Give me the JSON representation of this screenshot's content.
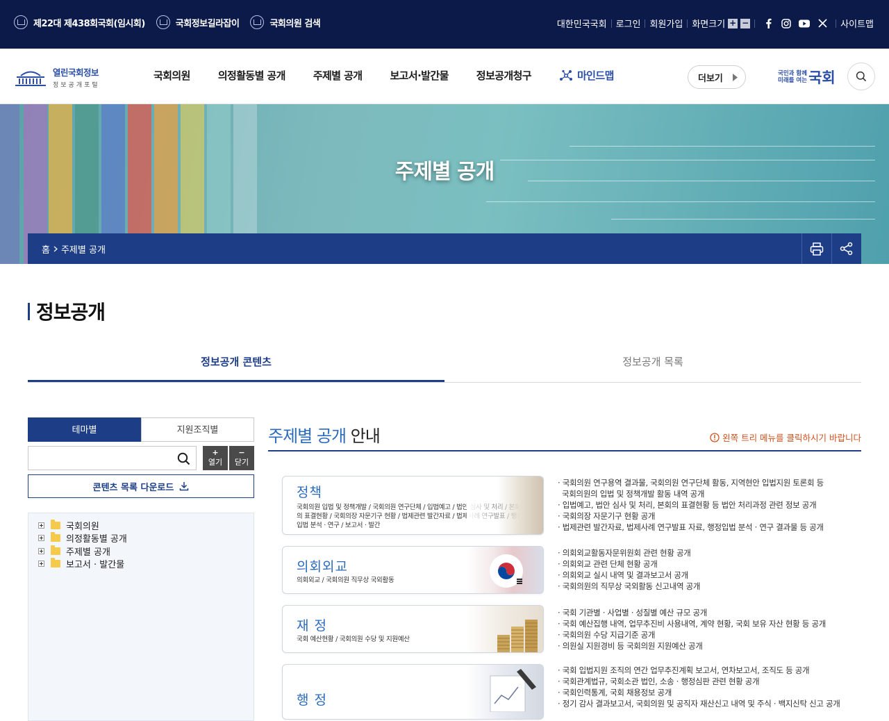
{
  "topbar": {
    "links": [
      "제22대 제438회국회(임시회)",
      "국회정보길라잡이",
      "국회의원 검색"
    ],
    "right": {
      "assembly": "대한민국국회",
      "login": "로그인",
      "signup": "회원가입",
      "zoom_label": "화면크기",
      "zoom_in": "+",
      "zoom_out": "−",
      "sitemap": "사이트맵",
      "social": [
        "facebook-icon",
        "instagram-icon",
        "youtube-icon",
        "x-icon"
      ]
    }
  },
  "header": {
    "logo_title": "열린국회정보",
    "logo_sub": "정보공개포털",
    "nav": [
      "국회의원",
      "의정활동별 공개",
      "주제별 공개",
      "보고서·발간물",
      "정보공개청구"
    ],
    "mindmap": "마인드맵",
    "more": "더보기",
    "slogan_small_1": "국민과 함께",
    "slogan_small_2": "미래를 여는",
    "slogan_big": "국회"
  },
  "banner": {
    "title": "주제별 공개",
    "breadcrumb_home": "홈",
    "breadcrumb_current": "주제별 공개"
  },
  "section": {
    "title": "정보공개",
    "tabs": [
      "정보공개 콘텐츠",
      "정보공개 목록"
    ]
  },
  "left_panel": {
    "tabs": [
      "테마별",
      "지원조직별"
    ],
    "search_placeholder": "",
    "open_label": "열기",
    "close_label": "닫기",
    "download_label": "콘텐츠 목록 다운로드",
    "tree": [
      "국회의원",
      "의정활동별 공개",
      "주제별 공개",
      "보고서 · 발간물"
    ]
  },
  "content": {
    "title_blue": "주제별 공개",
    "title_dark": "안내",
    "note": "왼쪽 트리 메뉴를 클릭하시기 바랍니다",
    "cards": [
      {
        "title": "정책",
        "sub": "국회의원 입법 및 정책개발 / 국회의원 연구단체 / 입법예고 / 법안 심사 및 처리 / 본회의 표결현황 / 국회의장 자문기구 현황 / 법제관련 발간자료 / 법제사례 연구발표 / 행정입법 분석 · 연구 / 보고서 · 발간",
        "desc": [
          "· 국회의원 연구용역 결과물, 국회의원 연구단체 활동, 지역현안 입법지원 토론회 등",
          "  국회의원의 입법 및 정책개발 활동 내역 공개",
          "· 입법예고, 법안 심사 및 처리, 본회의 표결현황 등 법안 처리과정 관련 정보 공개",
          "· 국회의장 자문기구 현황 공개",
          "· 법제관련 발간자료, 법제사례 연구발표 자료, 행정입법 분석 · 연구 결과물 등 공개"
        ]
      },
      {
        "title": "의회외교",
        "sub": "의회외교 / 국회의원 직무상 국외활동",
        "desc": [
          "· 의회외교활동자문위원회 관련 현황 공개",
          "· 의회외교 관련 단체 현황 공개",
          "· 의회외교 실시 내역 및 결과보고서 공개",
          "· 국회의원의 직무상 국외활동 신고내역 공개"
        ]
      },
      {
        "title": "재 정",
        "sub": "국회 예산현황 / 국회의원 수당 및 지원예산",
        "desc": [
          "· 국회 기관별 · 사업별 · 성질별 예산 규모 공개",
          "· 국회 예산집행 내역, 업무추진비 사용내역, 계약 현황, 국회 보유 자산 현황 등 공개",
          "· 국회의원 수당 지급기준 공개",
          "· 의원실 지원경비 등 국회의원 지원예산 공개"
        ]
      },
      {
        "title": "행 정",
        "sub": "",
        "desc": [
          "· 국회 입법지원 조직의 연간 업무추진계획 보고서, 연차보고서, 조직도 등 공개",
          "· 국회관계법규, 국회소관 법인, 소송 · 행정심판 관련 현황 공개",
          "· 국회인력통계, 국회 채용정보 공개",
          "· 정기 감사 결과보고서, 국회의원 및 공직자 재산신고 내역 및 주식 · 백지신탁 신고 공개"
        ]
      }
    ]
  },
  "colors": {
    "navy": "#0c1a4a",
    "primary": "#1d3e87",
    "accent_blue": "#2a6bbd",
    "note_orange": "#d2511d"
  }
}
